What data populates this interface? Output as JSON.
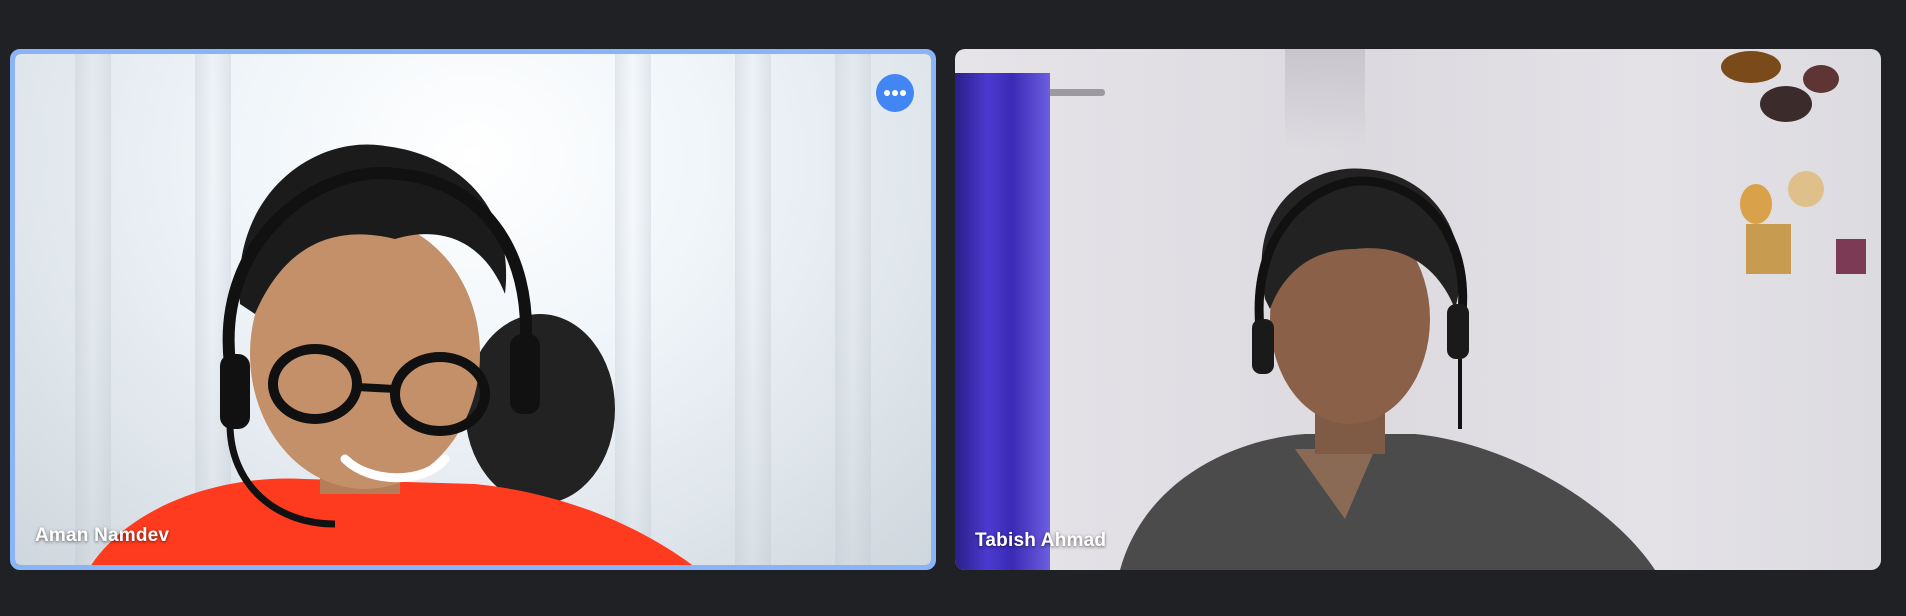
{
  "participants": [
    {
      "name": "Aman Namdev",
      "active_speaker": true,
      "shirt_color": "#ff3b1f"
    },
    {
      "name": "Tabish Ahmad",
      "active_speaker": false,
      "shirt_color": "#4a4a4a"
    }
  ],
  "colors": {
    "background": "#202124",
    "active_border": "#8ab4f8",
    "more_button": "#4285f4"
  },
  "controls": {
    "more_options_icon": "more-horiz-icon"
  }
}
